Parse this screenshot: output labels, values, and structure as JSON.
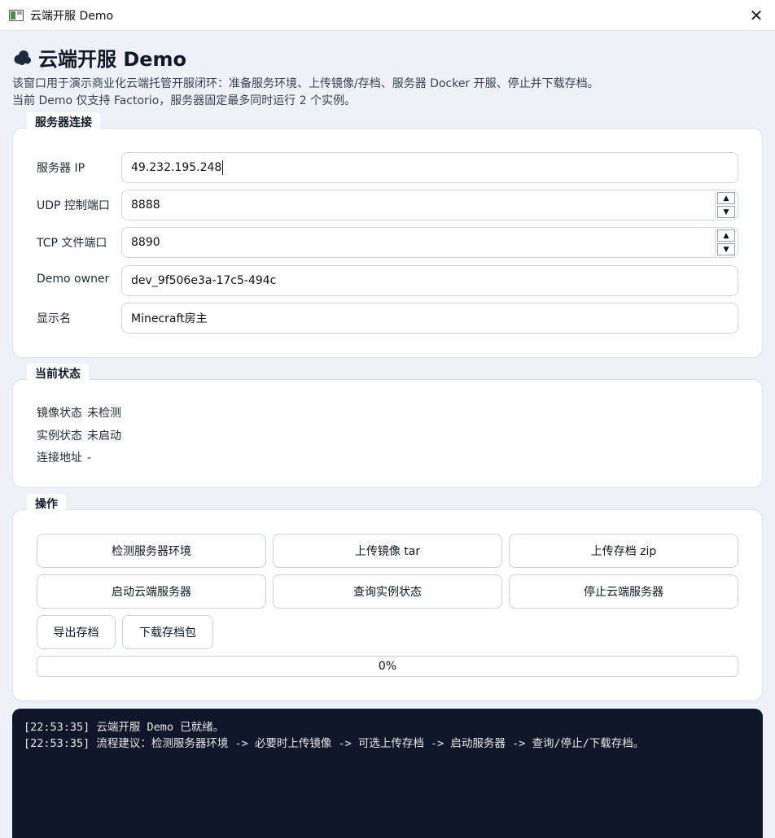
{
  "window": {
    "title": "云端开服 Demo"
  },
  "header": {
    "title": "云端开服 Demo",
    "desc_line1": "该窗口用于演示商业化云端托管开服闭环：准备服务环境、上传镜像/存档、服务器 Docker 开服、停止并下载存档。",
    "desc_line2": "当前 Demo 仅支持 Factorio，服务器固定最多同时运行 2 个实例。"
  },
  "connection": {
    "title": "服务器连接",
    "ip_label": "服务器 IP",
    "ip_value": "49.232.195.248",
    "udp_label": "UDP 控制端口",
    "udp_value": "8888",
    "tcp_label": "TCP 文件端口",
    "tcp_value": "8890",
    "owner_label": "Demo owner",
    "owner_value": "dev_9f506e3a-17c5-494c",
    "display_label": "显示名",
    "display_value": "Minecraft房主"
  },
  "status": {
    "title": "当前状态",
    "image_label": "镜像状态",
    "image_value": "未检测",
    "instance_label": "实例状态",
    "instance_value": "未启动",
    "address_label": "连接地址",
    "address_value": "-"
  },
  "actions": {
    "title": "操作",
    "check_env": "检测服务器环境",
    "upload_image": "上传镜像 tar",
    "upload_save": "上传存档 zip",
    "start_server": "启动云端服务器",
    "query_status": "查询实例状态",
    "stop_server": "停止云端服务器",
    "export_save": "导出存档",
    "download_save": "下载存档包",
    "progress_text": "0%",
    "progress_value": 0
  },
  "log": {
    "lines": [
      "[22:53:35] 云端开服 Demo 已就绪。",
      "[22:53:35] 流程建议：检测服务器环境 -> 必要时上传镜像 -> 可选上传存档 -> 启动服务器 -> 查询/停止/下载存档。"
    ]
  },
  "icons": {
    "app": "app-window-icon",
    "cloud": "cloud-icon",
    "close": "close-icon",
    "spin_up": "chevron-up-icon",
    "spin_down": "chevron-down-icon"
  }
}
